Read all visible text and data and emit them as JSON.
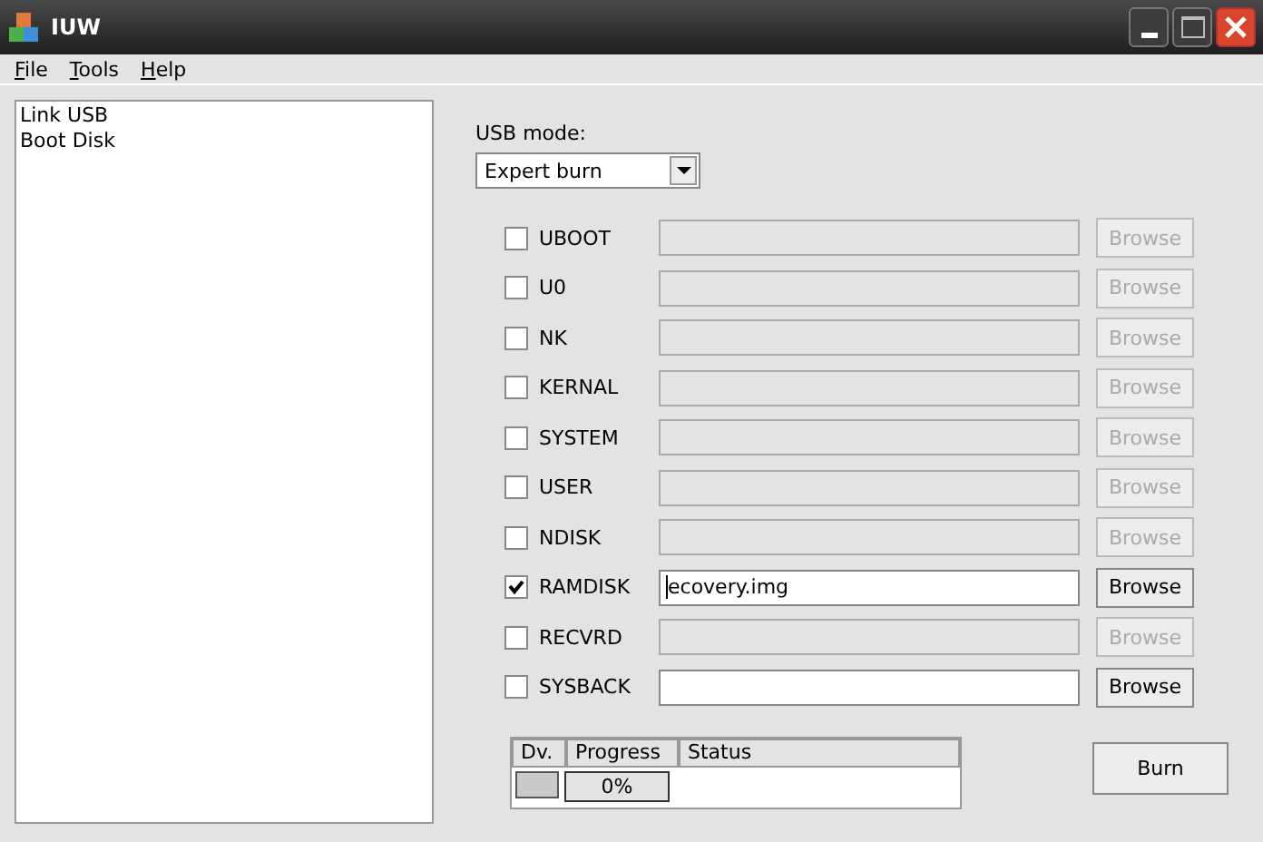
{
  "window": {
    "title": "IUW"
  },
  "menu": [
    {
      "label": "File"
    },
    {
      "label": "Tools"
    },
    {
      "label": "Help"
    }
  ],
  "sidebar": {
    "items": [
      {
        "label": "Link USB"
      },
      {
        "label": "Boot Disk"
      }
    ]
  },
  "usb_mode": {
    "label": "USB mode:",
    "value": "Expert burn"
  },
  "images": [
    {
      "name": "UBOOT",
      "checked": false,
      "field_enabled": false,
      "browse_enabled": false,
      "button": "Browse"
    },
    {
      "name": "U0",
      "checked": false,
      "field_enabled": false,
      "browse_enabled": false,
      "button": "Browse"
    },
    {
      "name": "NK",
      "checked": false,
      "field_enabled": false,
      "browse_enabled": false,
      "button": "Browse"
    },
    {
      "name": "KERNAL",
      "checked": false,
      "field_enabled": false,
      "browse_enabled": false,
      "button": "Browse"
    },
    {
      "name": "SYSTEM",
      "checked": false,
      "field_enabled": false,
      "browse_enabled": false,
      "button": "Browse"
    },
    {
      "name": "USER",
      "checked": false,
      "field_enabled": false,
      "browse_enabled": false,
      "button": "Browse"
    },
    {
      "name": "NDISK",
      "checked": false,
      "field_enabled": false,
      "browse_enabled": false,
      "button": "Browse"
    },
    {
      "name": "RAMDISK",
      "checked": true,
      "field_enabled": true,
      "browse_enabled": true,
      "button": "Browse",
      "value": "ecovery.img",
      "caret": true
    },
    {
      "name": "RECVRD",
      "checked": false,
      "field_enabled": false,
      "browse_enabled": false,
      "button": "Browse"
    },
    {
      "name": "SYSBACK",
      "checked": false,
      "field_enabled": true,
      "browse_enabled": true,
      "button": "Browse"
    }
  ],
  "devices": {
    "columns": [
      "Dv.",
      "Progress",
      "Status"
    ],
    "rows": [
      {
        "level": 0,
        "reading": "0%"
      }
    ]
  },
  "burn_button": "Burn"
}
